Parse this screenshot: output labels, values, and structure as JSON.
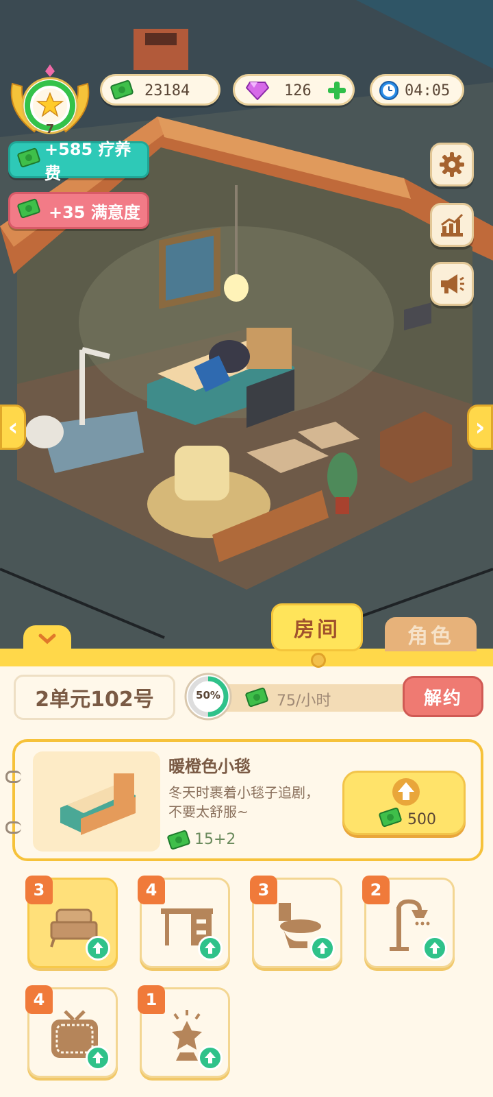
{
  "hud": {
    "level": "7",
    "cash": "23184",
    "gems": "126",
    "timer": "04:05",
    "bonus_care_fee": "+585 疗养费",
    "bonus_satisfaction": "+35 满意度"
  },
  "side_buttons": [
    "gear-icon",
    "chart-icon",
    "megaphone-icon"
  ],
  "tabs": {
    "room": "房间",
    "character": "角色"
  },
  "room": {
    "name": "2单元102号",
    "progress_label": "50%",
    "progress_value": 0.5,
    "income": "75/小时",
    "terminate_label": "解约"
  },
  "item": {
    "title": "暖橙色小毯",
    "description": "冬天时裹着小毯子追剧，不要太舒服~",
    "stat": "15+2",
    "upgrade_cost": "500"
  },
  "furniture": [
    {
      "name": "bed",
      "level": "3",
      "active": true
    },
    {
      "name": "desk",
      "level": "4",
      "active": false
    },
    {
      "name": "toilet",
      "level": "3",
      "active": false
    },
    {
      "name": "shower",
      "level": "2",
      "active": false
    },
    {
      "name": "tv",
      "level": "4",
      "active": false
    },
    {
      "name": "lamp",
      "level": "1",
      "active": false
    }
  ],
  "colors": {
    "accent_yellow": "#ffd84a",
    "panel_bg": "#fff8ea",
    "bonus_teal": "#2ec9b7",
    "bonus_pink": "#f27b87",
    "terminate_red": "#ef7a72",
    "cash_green": "#3fbf4a"
  }
}
